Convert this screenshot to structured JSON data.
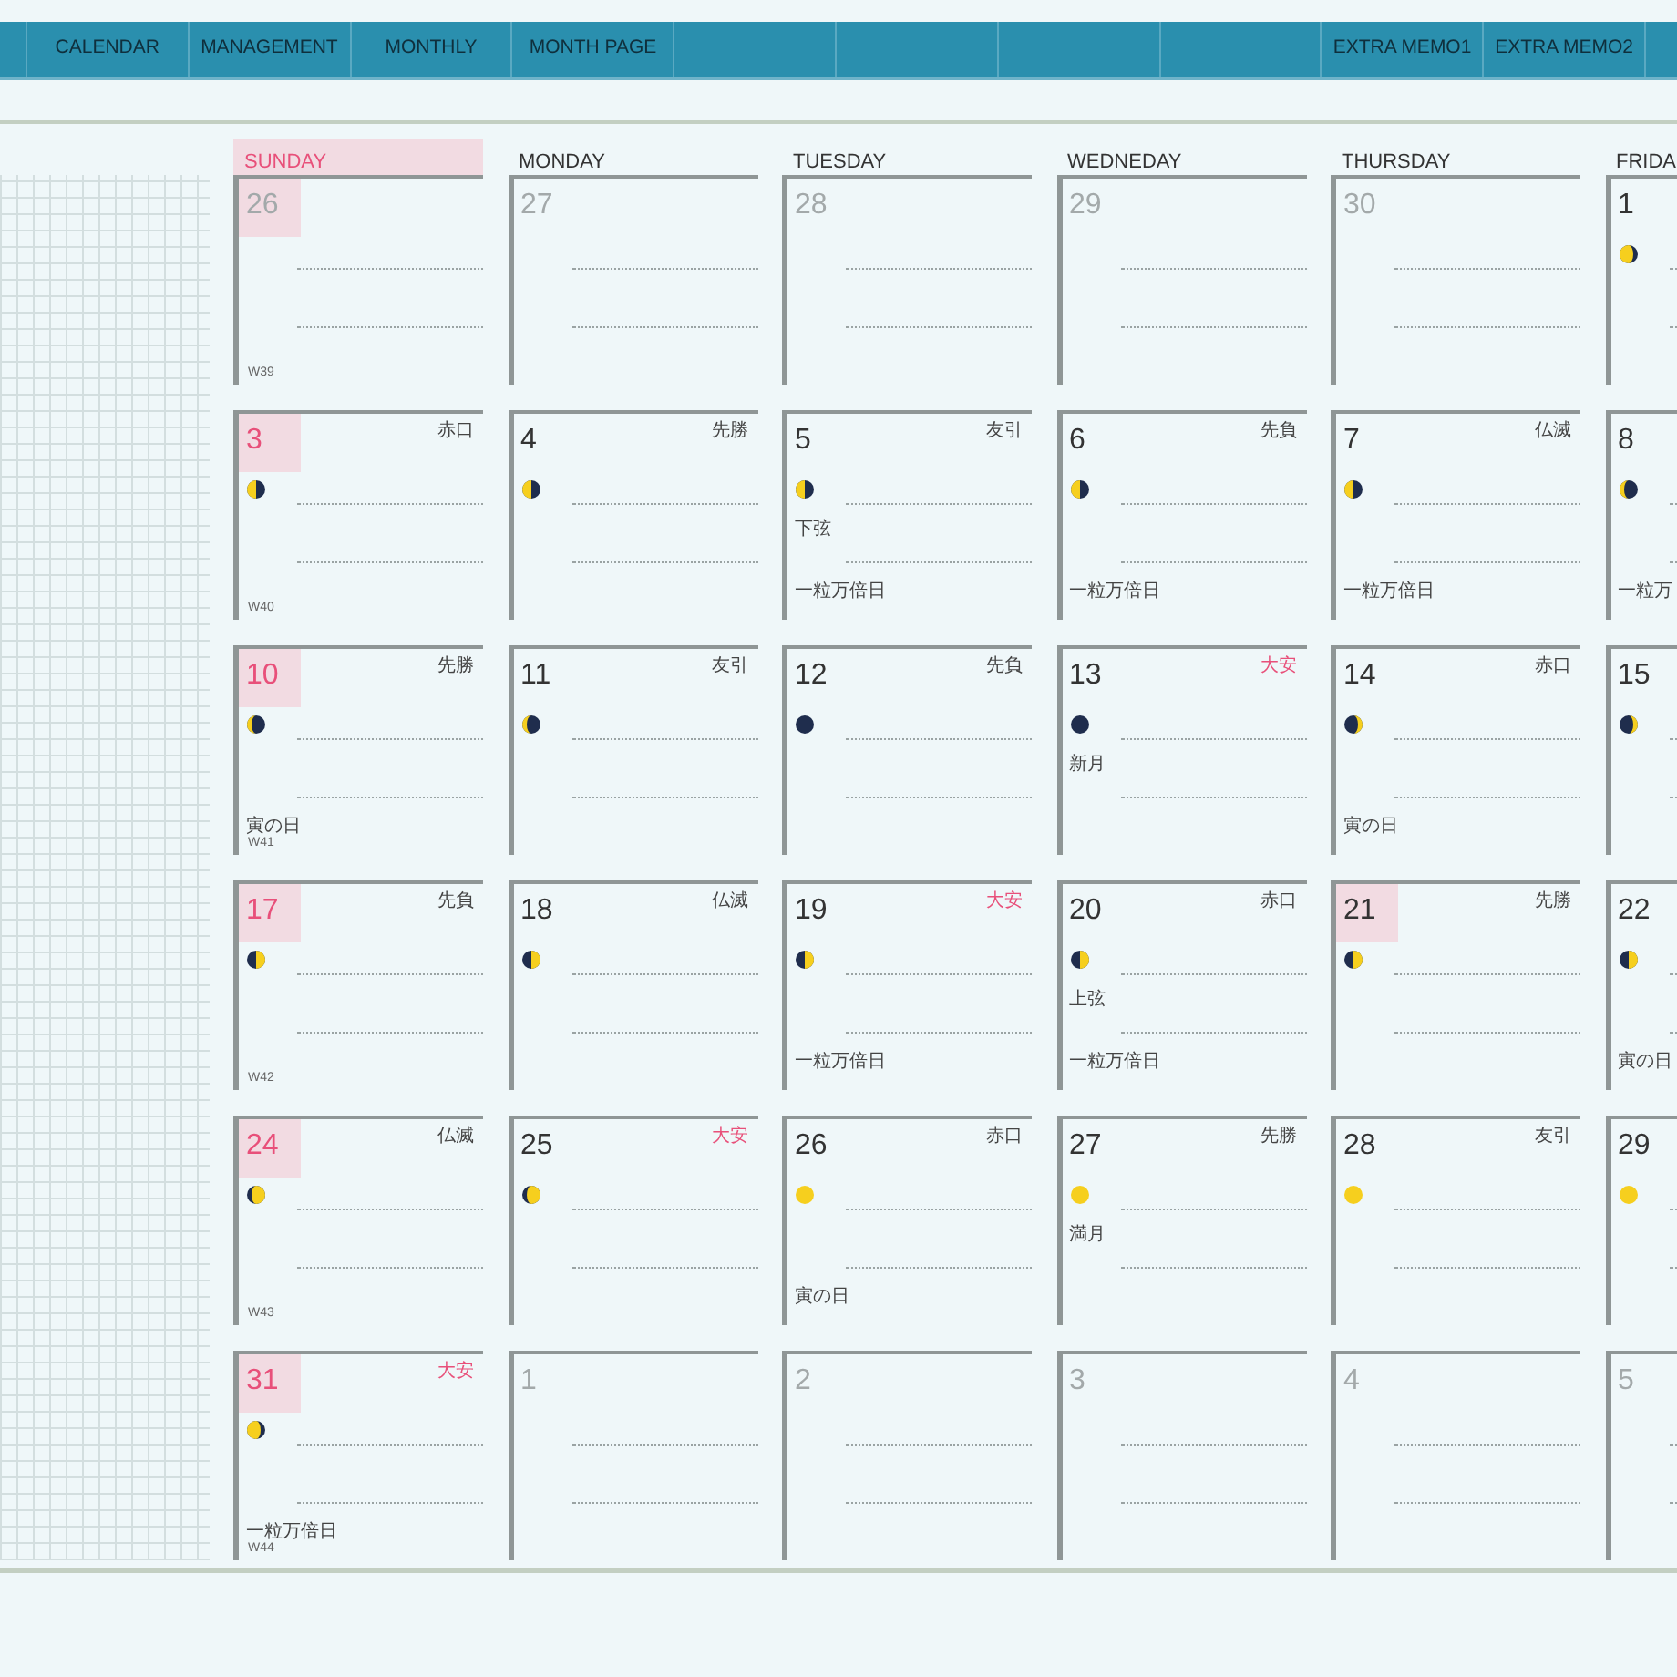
{
  "tabs": [
    {
      "kind": "blank"
    },
    {
      "kind": "label",
      "label": "CALENDAR"
    },
    {
      "kind": "label",
      "label": "MANAGEMENT"
    },
    {
      "kind": "label",
      "label": "MONTHLY"
    },
    {
      "kind": "label",
      "label": "MONTH PAGE"
    },
    {
      "kind": "blank"
    },
    {
      "kind": "blank"
    },
    {
      "kind": "blank"
    },
    {
      "kind": "blank"
    },
    {
      "kind": "label",
      "label": "EXTRA MEMO1"
    },
    {
      "kind": "label",
      "label": "EXTRA MEMO2"
    }
  ],
  "columns": [
    {
      "label": "SUNDAY",
      "highlighted": true
    },
    {
      "label": "MONDAY",
      "highlighted": false
    },
    {
      "label": "TUESDAY",
      "highlighted": false
    },
    {
      "label": "WEDNEDAY",
      "highlighted": false
    },
    {
      "label": "THURSDAY",
      "highlighted": false
    },
    {
      "label": "FRIDA",
      "highlighted": false
    }
  ],
  "rows": [
    {
      "cells": [
        {
          "date": "26",
          "out_of_month": true,
          "marked": true,
          "week": "W39"
        },
        {
          "date": "27",
          "out_of_month": true,
          "marked": false
        },
        {
          "date": "28",
          "out_of_month": true,
          "marked": false
        },
        {
          "date": "29",
          "out_of_month": true,
          "marked": false
        },
        {
          "date": "30",
          "out_of_month": true,
          "marked": false
        },
        {
          "date": "1",
          "out_of_month": false,
          "marked": false,
          "moon": {
            "kind": "waning_gibbous"
          }
        }
      ]
    },
    {
      "cells": [
        {
          "date": "3",
          "out_of_month": false,
          "marked": true,
          "rokuyo": {
            "text": "赤口",
            "color": "#444444"
          },
          "moon": {
            "kind": "last_quarter"
          },
          "week": "W40"
        },
        {
          "date": "4",
          "out_of_month": false,
          "marked": false,
          "rokuyo": {
            "text": "先勝",
            "color": "#444444"
          },
          "moon": {
            "kind": "last_quarter"
          }
        },
        {
          "date": "5",
          "out_of_month": false,
          "marked": false,
          "rokuyo": {
            "text": "友引",
            "color": "#444444"
          },
          "moon": {
            "kind": "last_quarter"
          },
          "phase_note": "下弦",
          "day_note": "一粒万倍日"
        },
        {
          "date": "6",
          "out_of_month": false,
          "marked": false,
          "rokuyo": {
            "text": "先負",
            "color": "#444444"
          },
          "moon": {
            "kind": "last_quarter"
          },
          "day_note": "一粒万倍日"
        },
        {
          "date": "7",
          "out_of_month": false,
          "marked": false,
          "rokuyo": {
            "text": "仏滅",
            "color": "#444444"
          },
          "moon": {
            "kind": "last_quarter"
          },
          "day_note": "一粒万倍日"
        },
        {
          "date": "8",
          "out_of_month": false,
          "marked": false,
          "moon": {
            "kind": "waning_crescent"
          },
          "day_note": "一粒万"
        }
      ]
    },
    {
      "cells": [
        {
          "date": "10",
          "out_of_month": false,
          "marked": true,
          "rokuyo": {
            "text": "先勝",
            "color": "#444444"
          },
          "moon": {
            "kind": "waning_crescent"
          },
          "day_note": "寅の日",
          "week": "W41"
        },
        {
          "date": "11",
          "out_of_month": false,
          "marked": false,
          "rokuyo": {
            "text": "友引",
            "color": "#444444"
          },
          "moon": {
            "kind": "waning_crescent"
          }
        },
        {
          "date": "12",
          "out_of_month": false,
          "marked": false,
          "rokuyo": {
            "text": "先負",
            "color": "#444444"
          },
          "moon": {
            "kind": "new"
          }
        },
        {
          "date": "13",
          "out_of_month": false,
          "marked": false,
          "rokuyo": {
            "text": "大安",
            "color": "#e8507a"
          },
          "moon": {
            "kind": "new"
          },
          "phase_note": "新月"
        },
        {
          "date": "14",
          "out_of_month": false,
          "marked": false,
          "rokuyo": {
            "text": "赤口",
            "color": "#444444"
          },
          "moon": {
            "kind": "waxing_crescent"
          },
          "day_note": "寅の日"
        },
        {
          "date": "15",
          "out_of_month": false,
          "marked": false,
          "moon": {
            "kind": "waxing_crescent"
          }
        }
      ]
    },
    {
      "cells": [
        {
          "date": "17",
          "out_of_month": false,
          "marked": true,
          "rokuyo": {
            "text": "先負",
            "color": "#444444"
          },
          "moon": {
            "kind": "first_quarter"
          },
          "week": "W42"
        },
        {
          "date": "18",
          "out_of_month": false,
          "marked": false,
          "rokuyo": {
            "text": "仏滅",
            "color": "#444444"
          },
          "moon": {
            "kind": "first_quarter"
          }
        },
        {
          "date": "19",
          "out_of_month": false,
          "marked": false,
          "rokuyo": {
            "text": "大安",
            "color": "#e8507a"
          },
          "moon": {
            "kind": "first_quarter"
          },
          "day_note": "一粒万倍日"
        },
        {
          "date": "20",
          "out_of_month": false,
          "marked": false,
          "rokuyo": {
            "text": "赤口",
            "color": "#444444"
          },
          "moon": {
            "kind": "first_quarter"
          },
          "phase_note": "上弦",
          "day_note": "一粒万倍日"
        },
        {
          "date": "21",
          "out_of_month": false,
          "marked": true,
          "rokuyo": {
            "text": "先勝",
            "color": "#444444"
          },
          "moon": {
            "kind": "first_quarter"
          }
        },
        {
          "date": "22",
          "out_of_month": false,
          "marked": false,
          "moon": {
            "kind": "first_quarter"
          },
          "day_note": "寅の日"
        }
      ]
    },
    {
      "cells": [
        {
          "date": "24",
          "out_of_month": false,
          "marked": true,
          "rokuyo": {
            "text": "仏滅",
            "color": "#444444"
          },
          "moon": {
            "kind": "waxing_gibbous"
          },
          "week": "W43"
        },
        {
          "date": "25",
          "out_of_month": false,
          "marked": false,
          "rokuyo": {
            "text": "大安",
            "color": "#e8507a"
          },
          "moon": {
            "kind": "waxing_gibbous"
          }
        },
        {
          "date": "26",
          "out_of_month": false,
          "marked": false,
          "rokuyo": {
            "text": "赤口",
            "color": "#444444"
          },
          "moon": {
            "kind": "full"
          },
          "day_note": "寅の日"
        },
        {
          "date": "27",
          "out_of_month": false,
          "marked": false,
          "rokuyo": {
            "text": "先勝",
            "color": "#444444"
          },
          "moon": {
            "kind": "full"
          },
          "phase_note": "満月"
        },
        {
          "date": "28",
          "out_of_month": false,
          "marked": false,
          "rokuyo": {
            "text": "友引",
            "color": "#444444"
          },
          "moon": {
            "kind": "full"
          }
        },
        {
          "date": "29",
          "out_of_month": false,
          "marked": false,
          "moon": {
            "kind": "full"
          }
        }
      ]
    },
    {
      "cells": [
        {
          "date": "31",
          "out_of_month": false,
          "marked": true,
          "rokuyo": {
            "text": "大安",
            "color": "#e8507a"
          },
          "moon": {
            "kind": "waning_gibbous"
          },
          "day_note": "一粒万倍日",
          "week": "W44"
        },
        {
          "date": "1",
          "out_of_month": true,
          "marked": false
        },
        {
          "date": "2",
          "out_of_month": true,
          "marked": false
        },
        {
          "date": "3",
          "out_of_month": true,
          "marked": false
        },
        {
          "date": "4",
          "out_of_month": true,
          "marked": false
        },
        {
          "date": "5",
          "out_of_month": true,
          "marked": false
        }
      ]
    }
  ]
}
